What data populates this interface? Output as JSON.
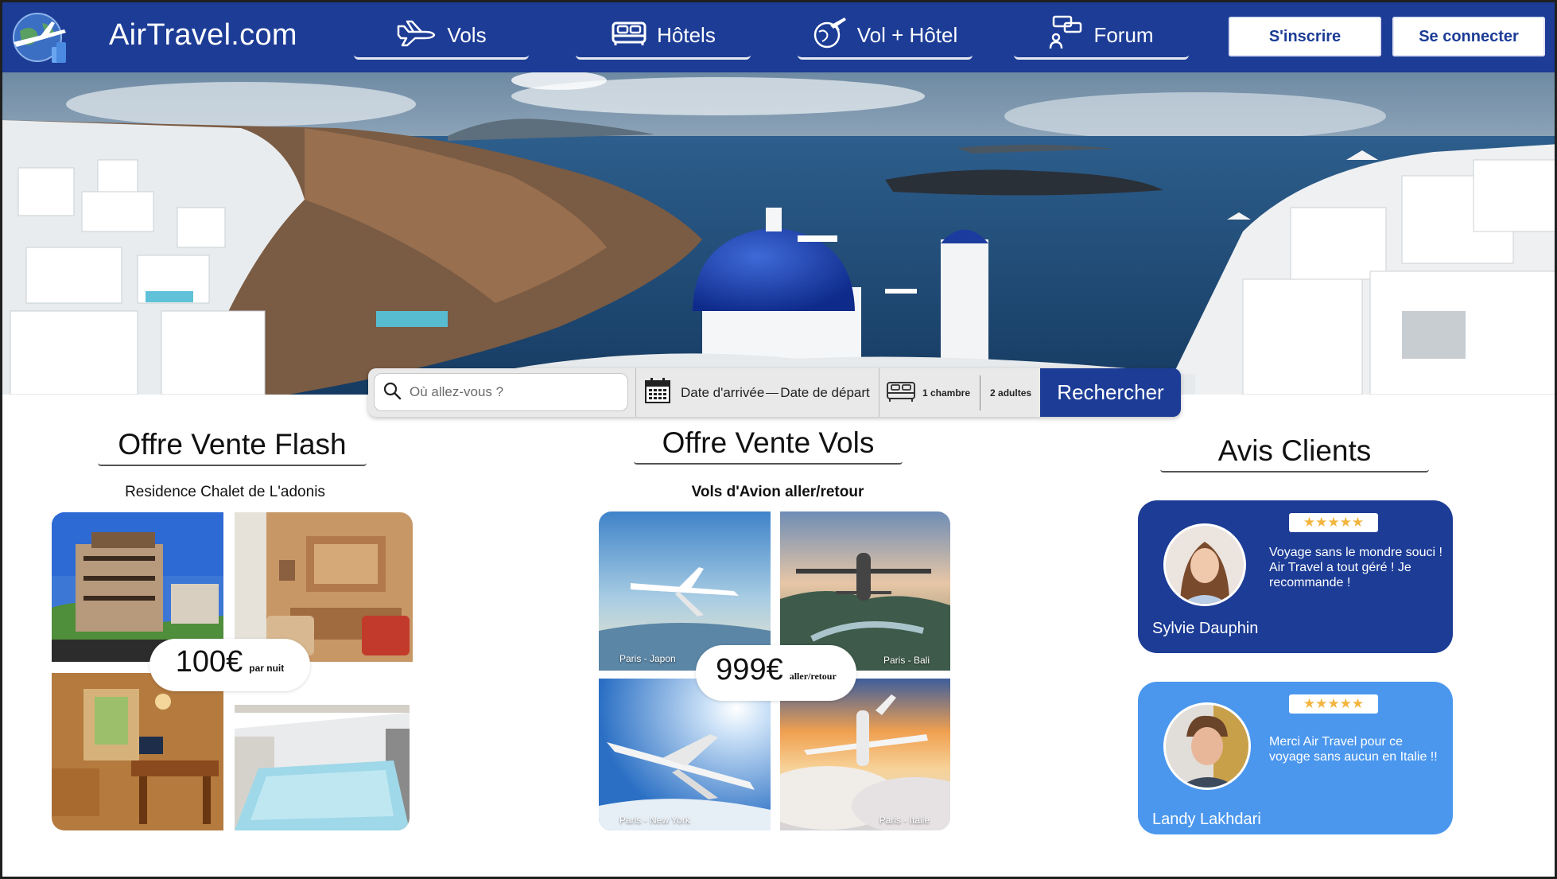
{
  "header": {
    "brand": "AirTravel.com",
    "nav": [
      {
        "label": "Vols",
        "icon": "plane-icon"
      },
      {
        "label": "Hôtels",
        "icon": "bed-icon"
      },
      {
        "label": "Vol + Hôtel",
        "icon": "globe-plane-icon"
      },
      {
        "label": "Forum",
        "icon": "chat-users-icon"
      }
    ],
    "signup_label": "S'inscrire",
    "login_label": "Se connecter"
  },
  "search": {
    "placeholder": "Où allez-vous ?",
    "arrival": "Date d'arrivée",
    "departure": "Date de départ",
    "rooms": "1 chambre",
    "guests": "2 adultes",
    "button": "Rechercher"
  },
  "flash": {
    "title": "Offre  Vente Flash",
    "subtitle": "Residence Chalet de L'adonis",
    "price": "100€",
    "unit": "par nuit"
  },
  "flights": {
    "title": "Offre  Vente Vols",
    "subtitle": "Vols d'Avion aller/retour",
    "price": "999€",
    "unit": "aller/retour",
    "destinations": [
      "Paris - Japon",
      "Paris - Bali",
      "Paris - New York",
      "Paris - Italie"
    ]
  },
  "reviews": {
    "title": "Avis Clients",
    "items": [
      {
        "name": "Sylvie Dauphin",
        "text": "Voyage sans le mondre souci ! Air Travel a tout géré ! Je recommande !",
        "stars": "★★★★★",
        "color": "#1c3c96"
      },
      {
        "name": "Landy Lakhdari",
        "text": "Merci Air Travel pour ce voyage sans aucun en Italie !!",
        "stars": "★★★★★",
        "color": "#4b97ee"
      }
    ]
  },
  "colors": {
    "primary": "#1c3c96",
    "accent": "#4b97ee",
    "star": "#f3b53f"
  }
}
